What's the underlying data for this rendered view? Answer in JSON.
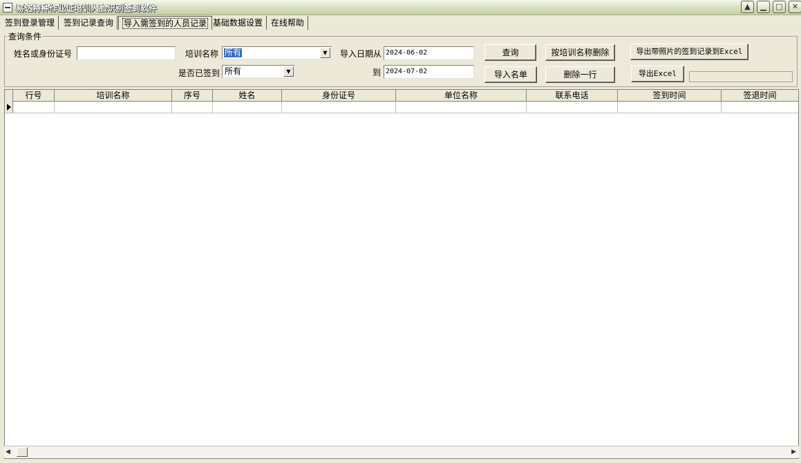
{
  "window": {
    "title": "易达特种作业证培训人脸识别签到软件",
    "controls": [
      "restore-up",
      "minimize",
      "maximize",
      "close"
    ]
  },
  "tabs": [
    {
      "label": "签到登录管理",
      "active": false
    },
    {
      "label": "签到记录查询",
      "active": false
    },
    {
      "label": "导入需签到的人员记录",
      "active": true
    },
    {
      "label": "基础数据设置",
      "active": false
    },
    {
      "label": "在线帮助",
      "active": false
    }
  ],
  "query": {
    "legend": "查询条件",
    "name_id_label": "姓名或身份证号",
    "name_id_value": "",
    "training_label": "培训名称",
    "training_value": "所有",
    "signed_label": "是否已签到",
    "signed_value": "所有",
    "date_from_label": "导入日期从",
    "date_from_value": "2024-06-02",
    "date_to_label": "到",
    "date_to_value": "2024-07-02"
  },
  "buttons": {
    "query": "查询",
    "import_list": "导入名单",
    "delete_by_training": "按培训名称删除",
    "delete_row": "删除一行",
    "export_with_photos": "导出带照片的签到记录到Excel",
    "export_excel": "导出Excel"
  },
  "grid": {
    "columns": [
      "行号",
      "培训名称",
      "序号",
      "姓名",
      "身份证号",
      "单位名称",
      "联系电话",
      "签到时间",
      "签退时间"
    ],
    "rows": [
      [
        "",
        "",
        "",
        "",
        "",
        "",
        "",
        "",
        ""
      ]
    ]
  },
  "colors": {
    "face": "#ece9d8",
    "selection": "#316ac5",
    "titlebar": "#c6cfa2"
  }
}
